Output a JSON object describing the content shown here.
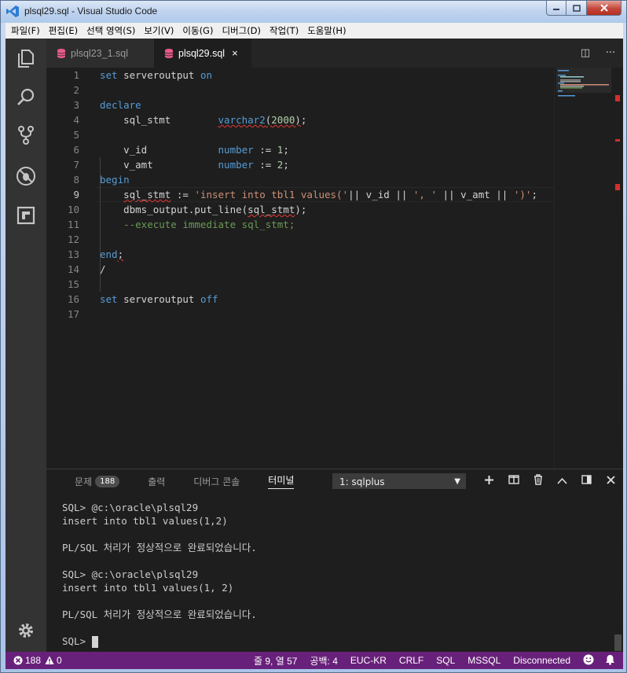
{
  "window": {
    "title": "plsql29.sql - Visual Studio Code",
    "min": "0",
    "max": "1",
    "close": "r"
  },
  "menu": [
    "파일(F)",
    "편집(E)",
    "선택 영역(S)",
    "보기(V)",
    "이동(G)",
    "디버그(D)",
    "작업(T)",
    "도움말(H)"
  ],
  "tabs": [
    {
      "label": "plsql23_1.sql",
      "active": false
    },
    {
      "label": "plsql29.sql",
      "active": true,
      "close": "×"
    }
  ],
  "tab_actions": {
    "split": "◫",
    "more": "···"
  },
  "editor": {
    "line_numbers": [
      "1",
      "2",
      "3",
      "4",
      "5",
      "6",
      "7",
      "8",
      "9",
      "10",
      "11",
      "12",
      "13",
      "14",
      "15",
      "16",
      "17"
    ],
    "active_line": 9
  },
  "panel": {
    "tabs": [
      {
        "label": "문제",
        "badge": "188"
      },
      {
        "label": "출력"
      },
      {
        "label": "디버그 콘솔"
      },
      {
        "label": "터미널",
        "active": true
      }
    ],
    "terminal_select": "1: sqlplus",
    "terminal_lines": [
      "SQL> @c:\\oracle\\plsql29",
      "insert into tbl1 values(1,2)",
      "",
      "PL/SQL 처리가 정상적으로 완료되었습니다.",
      "",
      "SQL> @c:\\oracle\\plsql29",
      "insert into tbl1 values(1, 2)",
      "",
      "PL/SQL 처리가 정상적으로 완료되었습니다.",
      ""
    ],
    "prompt": "SQL> "
  },
  "status": {
    "errors": "188",
    "warnings": "0",
    "position": "줄 9, 열 57",
    "spaces": "공백: 4",
    "encoding": "EUC-KR",
    "eol": "CRLF",
    "language": "SQL",
    "connection_type": "MSSQL",
    "connection": "Disconnected"
  },
  "colors": {
    "statusbar": "#68217a",
    "keyword": "#569cd6",
    "string": "#ce9178",
    "number": "#b5cea8",
    "comment": "#6a9955"
  }
}
